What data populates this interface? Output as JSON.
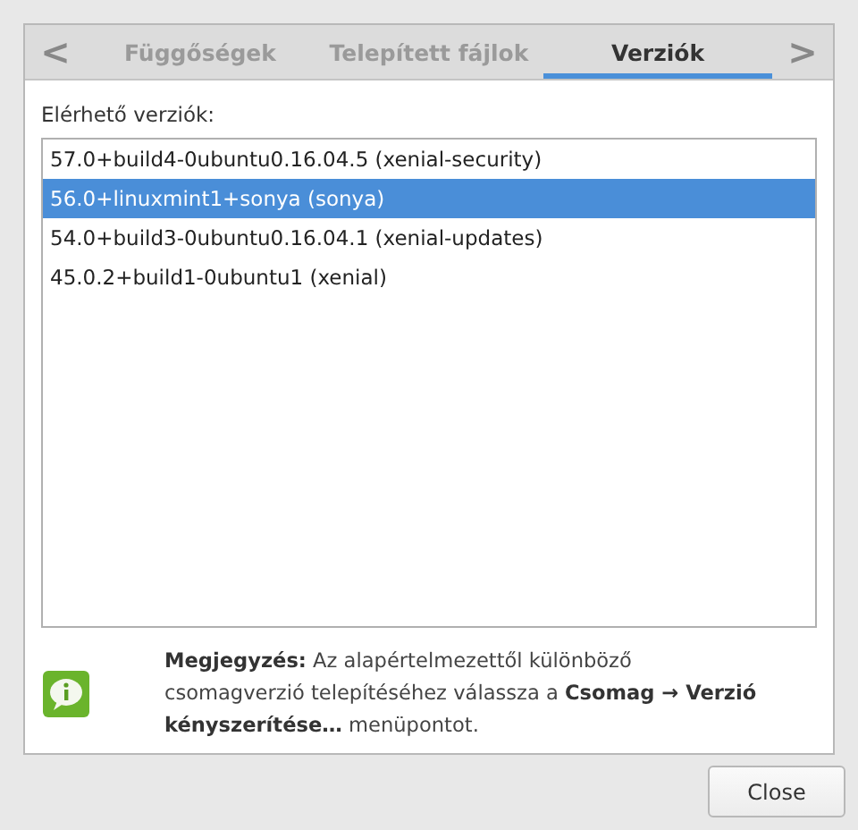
{
  "tabs": [
    {
      "label": "Függőségek",
      "selected": false
    },
    {
      "label": "Telepített fájlok",
      "selected": false
    },
    {
      "label": "Verziók",
      "selected": true
    }
  ],
  "nav": {
    "prev": "<",
    "next": ">"
  },
  "versions_label": "Elérhető verziók:",
  "versions": [
    {
      "label": "57.0+build4-0ubuntu0.16.04.5 (xenial-security)",
      "selected": false
    },
    {
      "label": "56.0+linuxmint1+sonya (sonya)",
      "selected": true
    },
    {
      "label": "54.0+build3-0ubuntu0.16.04.1 (xenial-updates)",
      "selected": false
    },
    {
      "label": "45.0.2+build1-0ubuntu1 (xenial)",
      "selected": false
    }
  ],
  "note": "**Megjegyzés:** Az alapértelmezettől különböző csomagverzió telepítéséhez válassza a **Csomag → Verzió kényszerítése…** menüpontot.",
  "buttons": [
    "Close"
  ]
}
